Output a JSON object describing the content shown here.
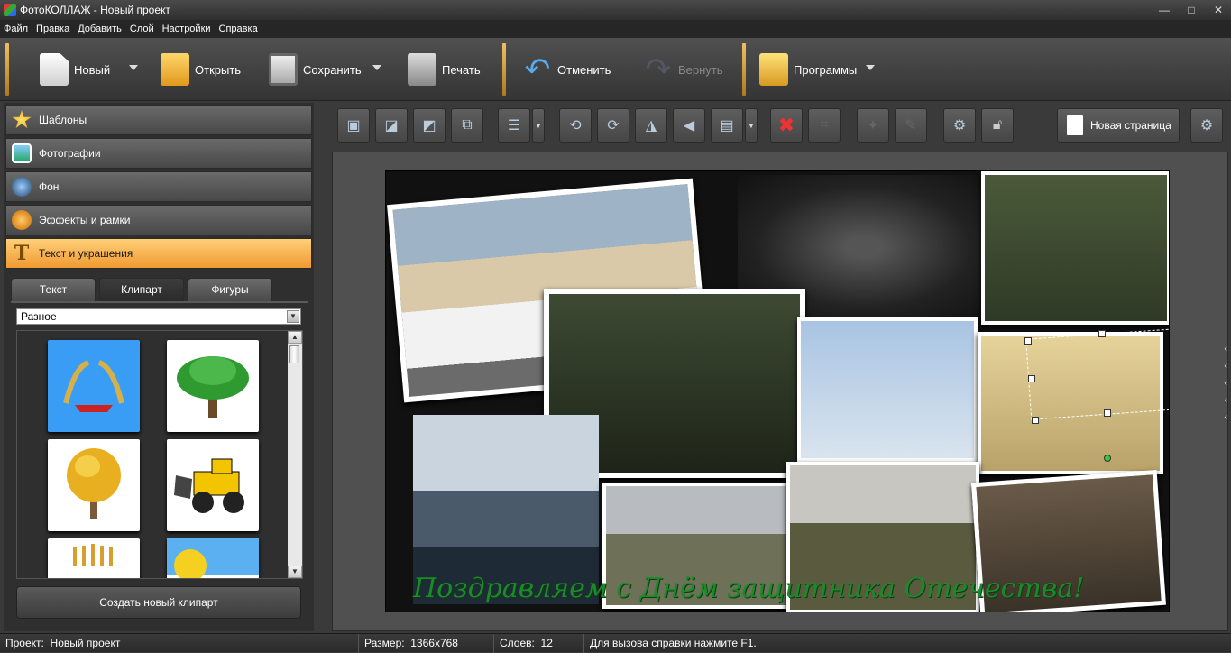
{
  "window": {
    "title": "ФотоКОЛЛАЖ - Новый проект",
    "minimize": "—",
    "maximize": "□",
    "close": "✕"
  },
  "menu": [
    "Файл",
    "Правка",
    "Добавить",
    "Слой",
    "Настройки",
    "Справка"
  ],
  "toolbar": {
    "new": "Новый",
    "open": "Открыть",
    "save": "Сохранить",
    "print": "Печать",
    "undo": "Отменить",
    "redo": "Вернуть",
    "programs": "Программы"
  },
  "sidebar": {
    "categories": [
      "Шаблоны",
      "Фотографии",
      "Фон",
      "Эффекты и рамки",
      "Текст и украшения"
    ],
    "active_category": "Текст и украшения",
    "tabs": [
      "Текст",
      "Клипарт",
      "Фигуры"
    ],
    "active_tab": "Клипарт",
    "dropdown_value": "Разное",
    "clipart_items": [
      "wheat-wreath-ribbon",
      "green-tree",
      "autumn-tree",
      "bulldozer",
      "wheat-bundle",
      "sun"
    ],
    "create_button": "Создать новый клипарт"
  },
  "editor": {
    "new_page_button": "Новая страница",
    "tools": [
      "bring-front",
      "bring-forward",
      "send-backward",
      "send-back",
      "align",
      "rotate-left",
      "rotate-right",
      "flip-horizontal",
      "flip-vertical",
      "fit",
      "delete",
      "crop",
      "effects",
      "brush",
      "settings",
      "lock"
    ]
  },
  "canvas": {
    "caption": "Поздравляем с Днём защитника Отечества!"
  },
  "status": {
    "project_label": "Проект:",
    "project_value": "Новый проект",
    "size_label": "Размер:",
    "size_value": "1366x768",
    "layers_label": "Слоев:",
    "layers_value": "12",
    "hint": "Для вызова справки нажмите F1."
  },
  "colors": {
    "accent": "#f0a040",
    "caption": "#1c8a2a"
  }
}
